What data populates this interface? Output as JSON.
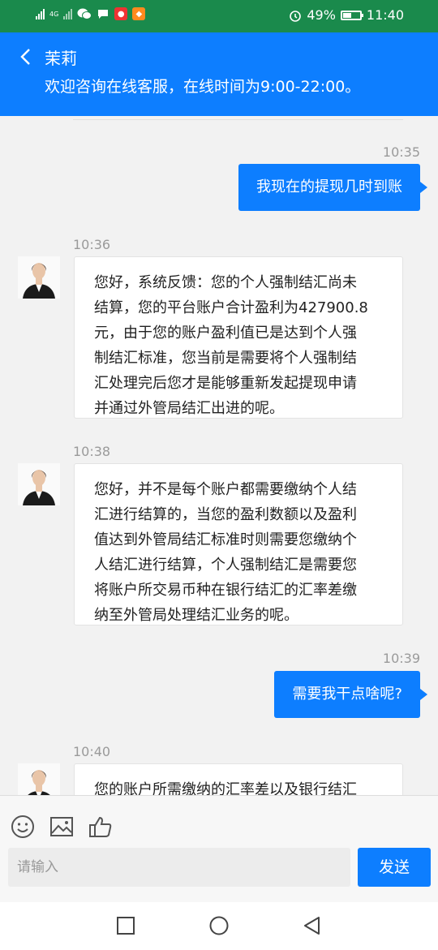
{
  "status_bar": {
    "network_label": "4G",
    "battery_percent": "49%",
    "battery_level": 0.49,
    "time": "11:40",
    "icons": [
      "wechat-icon",
      "chat-icon",
      "app-icon-red",
      "app-icon-orange",
      "alarm-icon",
      "battery-icon"
    ]
  },
  "header": {
    "title": "茉莉",
    "subtitle": "欢迎咨询在线客服，在线时间为9:00-22:00。",
    "color": "#0d7eff"
  },
  "messages": [
    {
      "side": "out",
      "time": "10:35",
      "text": "我现在的提现几时到账"
    },
    {
      "side": "in",
      "time": "10:36",
      "lines": [
        "您好，系统反馈：您的个人强制结汇尚未",
        "结算，您的平台账户合计盈利为427900.8",
        "元，由于您的账户盈利值已是达到个人强",
        "制结汇标准，您当前是需要将个人强制结",
        "汇处理完后您才是能够重新发起提现申请",
        "并通过外管局结汇出进的呢。"
      ]
    },
    {
      "side": "in",
      "time": "10:38",
      "lines": [
        "您好，并不是每个账户都需要缴纳个人结",
        "汇进行结算的，当您的盈利数额以及盈利",
        "值达到外管局结汇标准时则需要您缴纳个",
        "人结汇进行结算，个人强制结汇是需要您",
        "将账户所交易币种在银行结汇的汇率差缴",
        "纳至外管局处理结汇业务的呢。"
      ]
    },
    {
      "side": "out",
      "time": "10:39",
      "text": "需要我干点啥呢?"
    },
    {
      "side": "in",
      "time": "10:40",
      "lines": [
        "您的账户所需缴纳的汇率差以及银行结汇"
      ]
    }
  ],
  "composer": {
    "placeholder": "请输入",
    "send_label": "发送"
  }
}
